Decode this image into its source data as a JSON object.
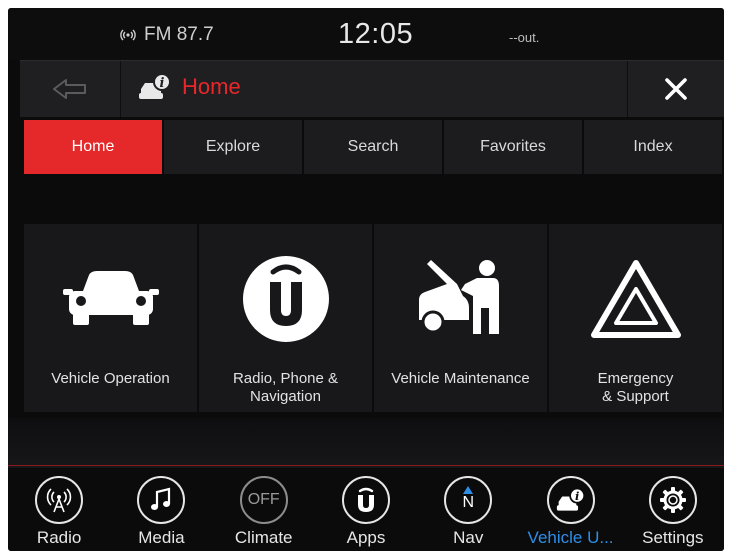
{
  "status": {
    "radio": "FM 87.7",
    "time": "12:05",
    "temperature": "--out."
  },
  "header": {
    "title": "Home",
    "back_icon": "back-arrow-icon",
    "close_icon": "close-icon",
    "title_icon": "vehicle-info-icon"
  },
  "tabs": [
    {
      "label": "Home",
      "active": true
    },
    {
      "label": "Explore",
      "active": false
    },
    {
      "label": "Search",
      "active": false
    },
    {
      "label": "Favorites",
      "active": false
    },
    {
      "label": "Index",
      "active": false
    }
  ],
  "tiles": [
    {
      "label": "Vehicle Operation",
      "icon": "car-front-icon"
    },
    {
      "label": "Radio, Phone &\nNavigation",
      "icon": "uconnect-icon"
    },
    {
      "label": "Vehicle Maintenance",
      "icon": "mechanic-icon"
    },
    {
      "label": "Emergency\n& Support",
      "icon": "hazard-triangle-icon"
    }
  ],
  "bottom_nav": [
    {
      "label": "Radio",
      "icon": "radio-icon",
      "active": false
    },
    {
      "label": "Media",
      "icon": "music-note-icon",
      "active": false
    },
    {
      "label": "Climate",
      "icon": "climate-off-icon",
      "icon_text": "OFF",
      "active": false
    },
    {
      "label": "Apps",
      "icon": "uconnect-apps-icon",
      "active": false
    },
    {
      "label": "Nav",
      "icon": "compass-icon",
      "icon_text": "N",
      "active": false
    },
    {
      "label": "Vehicle U...",
      "icon": "vehicle-info-icon",
      "active": true
    },
    {
      "label": "Settings",
      "icon": "gear-icon",
      "active": false
    }
  ],
  "colors": {
    "accent_red": "#e5292b",
    "active_blue": "#2e8ee6",
    "background": "#0b0b0c"
  }
}
